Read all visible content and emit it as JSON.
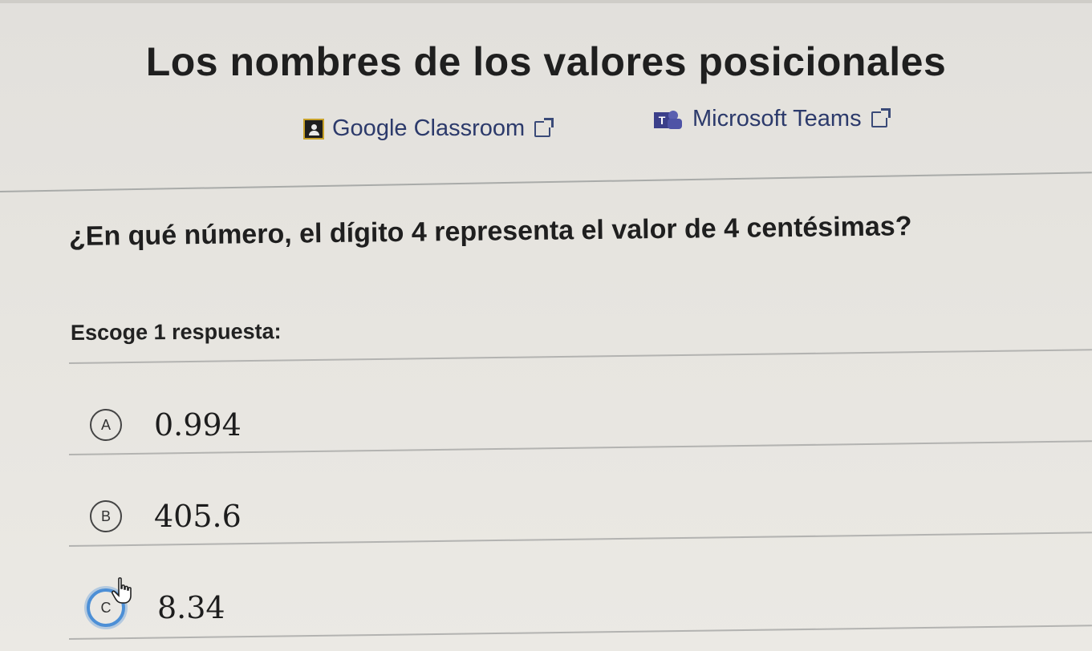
{
  "page": {
    "title": "Los nombres de los valores posicionales"
  },
  "share": {
    "google_classroom": {
      "label": "Google Classroom",
      "icon": "google-classroom-icon"
    },
    "microsoft_teams": {
      "label": "Microsoft Teams",
      "icon": "microsoft-teams-icon"
    },
    "external_icon": "external-link-icon"
  },
  "question": {
    "prompt": "¿En qué número, el dígito 4 representa el valor de 4 centésimas?",
    "instruction": "Escoge 1 respuesta:",
    "options": [
      {
        "letter": "A",
        "value": "0.994",
        "selected": false
      },
      {
        "letter": "B",
        "value": "405.6",
        "selected": false
      },
      {
        "letter": "C",
        "value": "8.34",
        "selected": true
      }
    ]
  },
  "colors": {
    "background": "#e4e2dd",
    "link": "#2c3a6b",
    "selected_ring": "#4c8fd6"
  }
}
